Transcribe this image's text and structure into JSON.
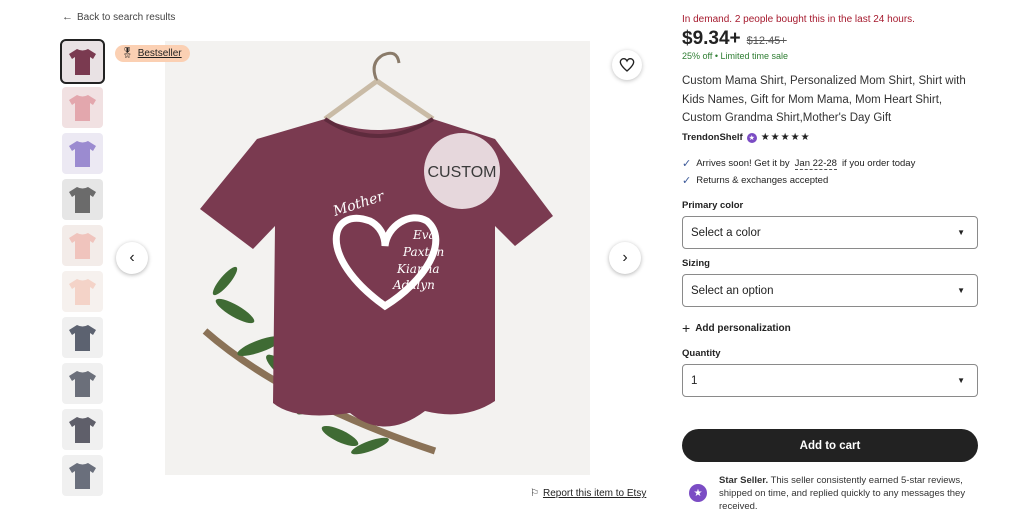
{
  "nav": {
    "back_label": "Back to search results"
  },
  "gallery": {
    "badge": "Bestseller",
    "custom_label": "CUSTOM",
    "shirt_words": [
      "Mother",
      "Eva",
      "Paxton",
      "Kianna",
      "Adalyn"
    ],
    "thumbnails": [
      {
        "color": "#7a3a50",
        "bg": "#e9e2e4"
      },
      {
        "color": "#e3a7ad",
        "bg": "#f1e1e2"
      },
      {
        "color": "#9b8bd0",
        "bg": "#ece9f3"
      },
      {
        "color": "#6b6b6b",
        "bg": "#e6e6e6"
      },
      {
        "color": "#f0c4bd",
        "bg": "#f3ece9"
      },
      {
        "color": "#f4d3c8",
        "bg": "#f6f1ee"
      },
      {
        "color": "#5c6270",
        "bg": "#f0f0f0"
      },
      {
        "color": "#6b6f7a",
        "bg": "#f0f0f0"
      },
      {
        "color": "#5f5f6a",
        "bg": "#f0f0f0"
      },
      {
        "color": "#6a6f7c",
        "bg": "#f0f0f0"
      }
    ]
  },
  "report_label": "Report this item to Etsy",
  "product": {
    "demand": "In demand. 2 people bought this in the last 24 hours.",
    "price": "$9.34+",
    "old_price": "$12.45+",
    "discount": "25% off  •  Limited time sale",
    "title": "Custom Mama Shirt, Personalized Mom Shirt, Shirt with Kids Names, Gift for Mom Mama, Mom Heart Shirt, Custom Grandma Shirt,Mother's Day Gift",
    "shop": "TrendonShelf",
    "stars": "★★★★★",
    "arrives_prefix": "Arrives soon! Get it by",
    "arrives_date": "Jan 22-28",
    "arrives_suffix": "if you order today",
    "returns": "Returns & exchanges accepted"
  },
  "options": {
    "color_label": "Primary color",
    "color_value": "Select a color",
    "sizing_label": "Sizing",
    "sizing_value": "Select an option",
    "personalize": "Add personalization",
    "quantity_label": "Quantity",
    "quantity_value": "1"
  },
  "cart": {
    "add_label": "Add to cart"
  },
  "star_seller": {
    "title": "Star Seller.",
    "text": " This seller consistently earned 5-star reviews, shipped on time, and replied quickly to any messages they received."
  },
  "colors": {
    "shirt": "#7a3a50",
    "demand": "#a61a2e",
    "sale": "#2e7d32",
    "badge": "#fbd0b3",
    "star_seller": "#7b4cc4"
  }
}
